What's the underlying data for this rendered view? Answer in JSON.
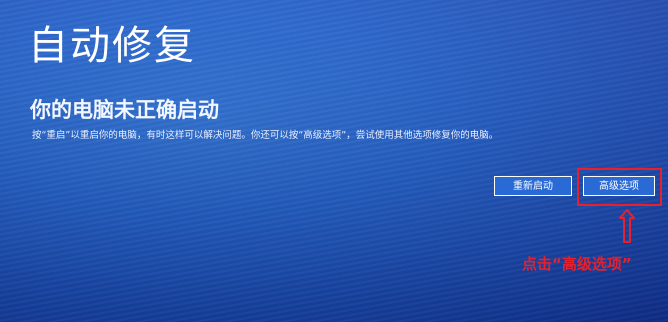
{
  "screen": {
    "title": "自动修复",
    "subtitle": "你的电脑未正确启动",
    "description": "按“重启”以重启你的电脑，有时这样可以解决问题。你还可以按“高级选项”，尝试使用其他选项修复你的电脑。"
  },
  "buttons": {
    "restart_label": "重新启动",
    "advanced_label": "高级选项"
  },
  "annotation": {
    "text": "点击“高级选项”",
    "color": "#e8202a"
  },
  "colors": {
    "background": "#1f5fcc",
    "button": "#2a6ad4",
    "text": "#ffffff"
  }
}
